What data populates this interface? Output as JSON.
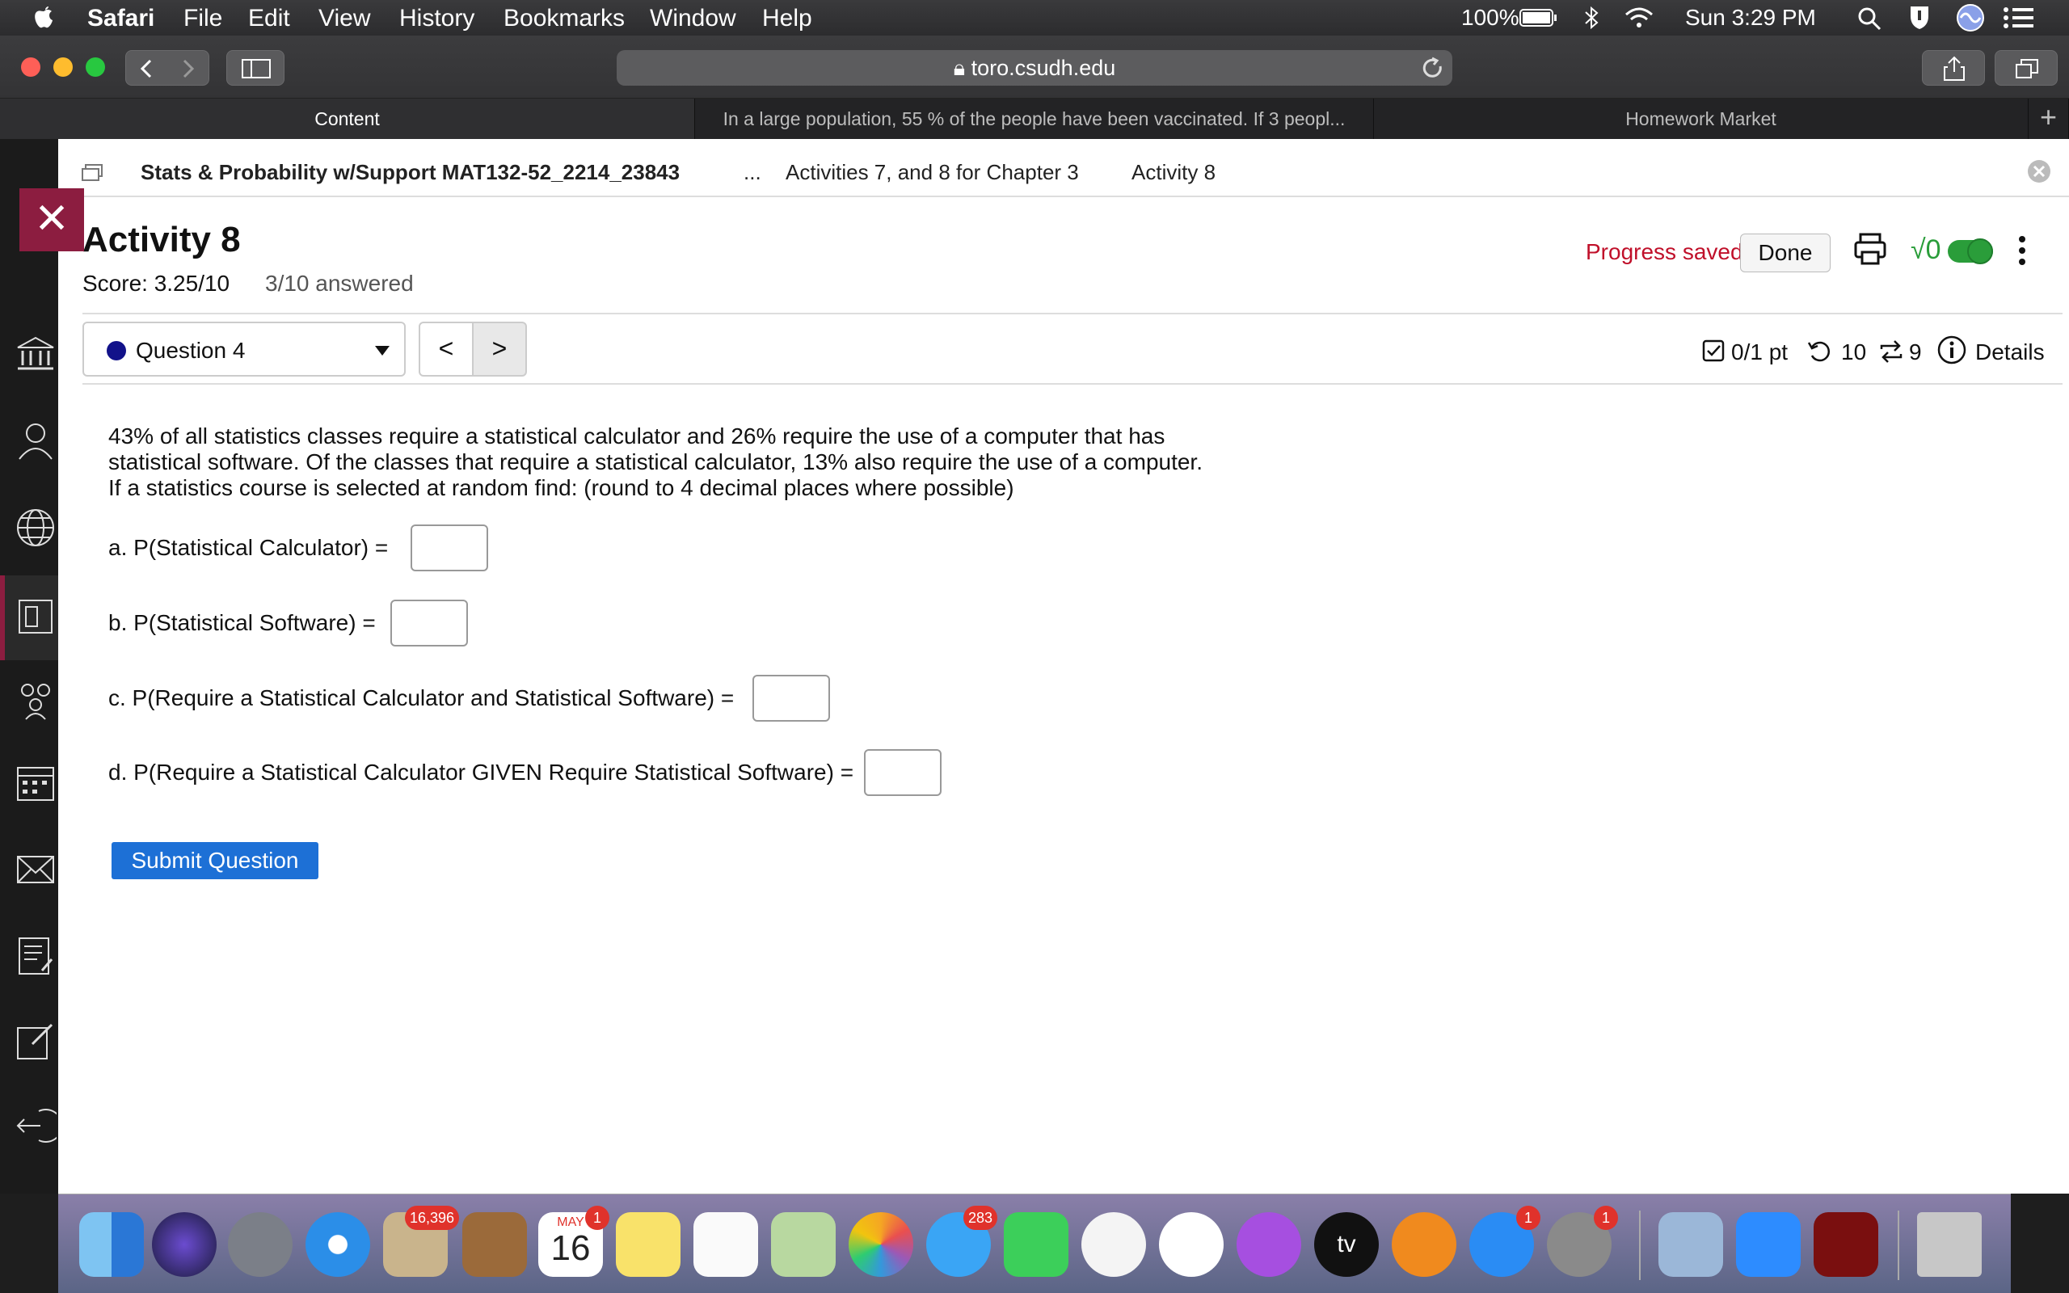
{
  "menubar": {
    "app": "Safari",
    "items": [
      "File",
      "Edit",
      "View",
      "History",
      "Bookmarks",
      "Window",
      "Help"
    ],
    "battery": "100%",
    "clock": "Sun 3:29 PM"
  },
  "browser": {
    "url": "toro.csudh.edu",
    "tabs": [
      {
        "label": "Content"
      },
      {
        "label": "In a large population, 55 % of the people have been vaccinated. If 3 peopl..."
      },
      {
        "label": "Homework Market"
      }
    ]
  },
  "breadcrumb": {
    "course": "Stats & Probability w/Support MAT132-52_2214_23843",
    "ellipsis": "...",
    "parent": "Activities 7, and 8 for Chapter 3",
    "current": "Activity 8"
  },
  "activity": {
    "title": "Activity 8",
    "score": "Score: 3.25/10",
    "answered": "3/10 answered",
    "progress": "Progress saved",
    "done_label": "Done",
    "sqrt_label": "√0"
  },
  "question_nav": {
    "selected": "Question 4",
    "prev": "<",
    "next": ">",
    "points": "0/1 pt",
    "retries": "10",
    "attempts": "9",
    "details": "Details"
  },
  "question": {
    "lines": [
      "43% of all statistics classes require a statistical calculator and 26% require the use of a computer that has",
      "statistical software. Of the classes that require a statistical calculator, 13% also require the use of a computer.",
      "If a statistics course is selected at random find: (round to 4 decimal places where possible)"
    ],
    "parts": [
      {
        "label": "a.  P(Statistical Calculator) =",
        "value": ""
      },
      {
        "label": "b. P(Statistical Software) =",
        "value": ""
      },
      {
        "label": "c. P(Require a Statistical Calculator and Statistical Software) =",
        "value": ""
      },
      {
        "label": "d. P(Require a Statistical Calculator GIVEN Require Statistical Software) =",
        "value": ""
      }
    ],
    "submit": "Submit Question"
  },
  "dock": {
    "mail_badge": "16,396",
    "calendar_month": "MAY",
    "calendar_day": "16",
    "calendar_badge": "1",
    "messages_badge": "283",
    "appstore_badge": "1",
    "settings_badge": "1",
    "tv_label": "tv"
  },
  "colors": {
    "accent_maroon": "#8c1d40",
    "progress_red": "#c0102a",
    "submit_blue": "#1d70d6",
    "toggle_green": "#2a9d3a"
  }
}
